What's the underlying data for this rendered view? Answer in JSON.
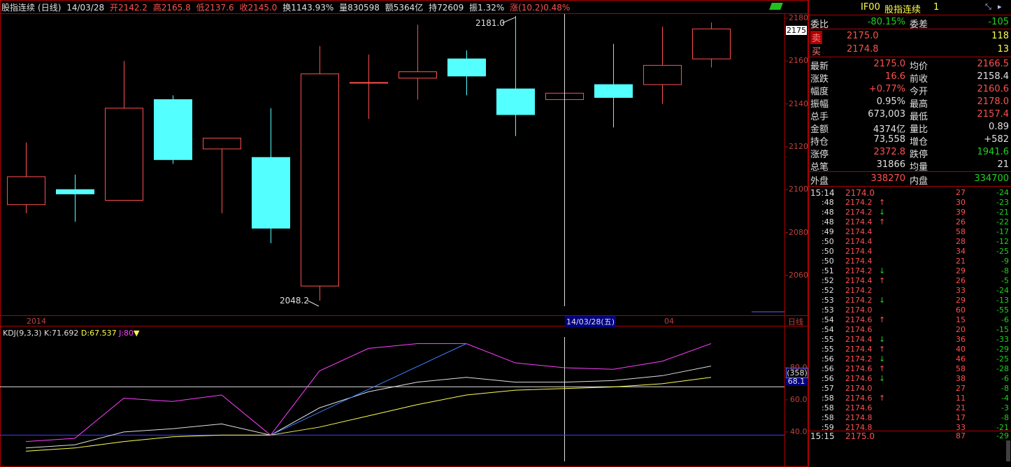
{
  "header": {
    "name": "股指连续",
    "period": "(日线)",
    "date": "14/03/28",
    "open": "开2142.2",
    "high": "高2165.8",
    "low": "低2137.6",
    "close": "收2145.0",
    "turnover": "换1143.93%",
    "volume": "量830598",
    "amount": "额5364亿",
    "hold": "持72609",
    "amplitude": "振1.32%",
    "change": "涨(10.2)0.48%"
  },
  "chart_data": [
    {
      "type": "candlestick",
      "title": "股指连续 (日线)",
      "y_ticks": [
        "2180",
        "2160",
        "2140",
        "2120",
        "2100",
        "2080",
        "2060"
      ],
      "ylim": [
        2044,
        2184
      ],
      "candles": [
        {
          "open": 2093,
          "close": 2106,
          "high": 2122,
          "low": 2089
        },
        {
          "open": 2100,
          "close": 2098,
          "high": 2107,
          "low": 2085
        },
        {
          "open": 2095,
          "close": 2138,
          "high": 2160,
          "low": 2095
        },
        {
          "open": 2142,
          "close": 2114,
          "high": 2144,
          "low": 2112
        },
        {
          "open": 2119,
          "close": 2124,
          "high": 2124,
          "low": 2089
        },
        {
          "open": 2115,
          "close": 2082,
          "high": 2138,
          "low": 2075
        },
        {
          "open": 2055,
          "close": 2154,
          "high": 2167,
          "low": 2048.2
        },
        {
          "open": 2150,
          "close": 2150,
          "high": 2163,
          "low": 2133
        },
        {
          "open": 2152,
          "close": 2155,
          "high": 2177,
          "low": 2142
        },
        {
          "open": 2161,
          "close": 2153,
          "high": 2165,
          "low": 2144
        },
        {
          "open": 2147,
          "close": 2135,
          "high": 2181,
          "low": 2125
        },
        {
          "open": 2142,
          "close": 2145,
          "high": 2166,
          "low": 2137
        },
        {
          "open": 2149,
          "close": 2143,
          "high": 2168,
          "low": 2129
        },
        {
          "open": 2149,
          "close": 2158,
          "high": 2176,
          "low": 2140
        },
        {
          "open": 2161,
          "close": 2175,
          "high": 2178,
          "low": 2157
        }
      ],
      "annotations": {
        "high_label": "2181.0",
        "low_label": "2048.2"
      },
      "price_tag": "2175",
      "x_labels": {
        "year": "2014",
        "month": "04",
        "cursor_date": "14/03/28(五)",
        "period_btn": "日线"
      }
    },
    {
      "type": "line",
      "title": "KDJ(9,3,3)",
      "ylim": [
        25,
        100
      ],
      "y_ticks": [
        "80.0",
        "60.0",
        "40.0"
      ],
      "legend": [
        {
          "label": "K:71.692",
          "color": "#e0e0e0"
        },
        {
          "label": "D:67.537",
          "color": "#ffff50"
        },
        {
          "label": "J:80",
          "color": "#ff40ff"
        }
      ],
      "series": [
        {
          "name": "K",
          "color": "#e0e0e0",
          "values": [
            30,
            32,
            40,
            42,
            45,
            38,
            55,
            65,
            71,
            74,
            71,
            71,
            72,
            75,
            81
          ]
        },
        {
          "name": "D",
          "color": "#ffff50",
          "values": [
            28,
            30,
            34,
            37,
            38,
            38,
            43,
            50,
            57,
            63,
            66,
            67,
            68,
            70,
            74
          ]
        },
        {
          "name": "J",
          "color": "#ff40ff",
          "values": [
            34,
            36,
            61,
            59,
            63,
            38,
            78,
            92,
            95,
            95,
            83,
            80,
            79,
            84,
            95
          ]
        }
      ],
      "cursor_value": "68.1",
      "cursor_count": "(358)"
    }
  ],
  "panel": {
    "code": "IF00",
    "name": "股指连续",
    "index": "1",
    "weibi_label": "委比",
    "weibi": "-80.15%",
    "weicha_label": "委差",
    "weicha": "-105",
    "sell_label": "卖",
    "sell_price": "2175.0",
    "sell_vol": "118",
    "buy_label": "买",
    "buy_price": "2174.8",
    "buy_vol": "13",
    "stats": [
      {
        "l1": "最新",
        "v1": "2175.0",
        "c1": "#ff5050",
        "l2": "均价",
        "v2": "2166.5",
        "c2": "#ff5050"
      },
      {
        "l1": "涨跌",
        "v1": "16.6",
        "c1": "#ff5050",
        "l2": "前收",
        "v2": "2158.4",
        "c2": "#e0e0e0"
      },
      {
        "l1": "幅度",
        "v1": "+0.77%",
        "c1": "#ff5050",
        "l2": "今开",
        "v2": "2160.6",
        "c2": "#ff5050"
      },
      {
        "l1": "振幅",
        "v1": "0.95%",
        "c1": "#e0e0e0",
        "l2": "最高",
        "v2": "2178.0",
        "c2": "#ff5050"
      },
      {
        "l1": "总手",
        "v1": "673,003",
        "c1": "#e0e0e0",
        "l2": "最低",
        "v2": "2157.4",
        "c2": "#ff5050"
      },
      {
        "l1": "金额",
        "v1": "4374亿",
        "c1": "#e0e0e0",
        "l2": "量比",
        "v2": "0.89",
        "c2": "#e0e0e0"
      },
      {
        "l1": "持仓",
        "v1": "73,558",
        "c1": "#e0e0e0",
        "l2": "增仓",
        "v2": "+582",
        "c2": "#e0e0e0"
      },
      {
        "l1": "涨停",
        "v1": "2372.8",
        "c1": "#ff5050",
        "l2": "跌停",
        "v2": "1941.6",
        "c2": "#20d020"
      },
      {
        "l1": "总笔",
        "v1": "31866",
        "c1": "#e0e0e0",
        "l2": "均量",
        "v2": "21",
        "c2": "#e0e0e0"
      }
    ],
    "outer_label": "外盘",
    "outer": "338270",
    "inner_label": "内盘",
    "inner": "334700",
    "ticks": [
      {
        "t": "15:14",
        "p": "2174.0",
        "a": "",
        "v": "27",
        "d": "-24"
      },
      {
        "t": ":48",
        "p": "2174.2",
        "a": "↑",
        "v": "30",
        "d": "-23"
      },
      {
        "t": ":48",
        "p": "2174.2",
        "a": "↓",
        "v": "39",
        "d": "-21"
      },
      {
        "t": ":48",
        "p": "2174.4",
        "a": "↑",
        "v": "26",
        "d": "-22"
      },
      {
        "t": ":49",
        "p": "2174.4",
        "a": "",
        "v": "58",
        "d": "-17"
      },
      {
        "t": ":50",
        "p": "2174.4",
        "a": "",
        "v": "28",
        "d": "-12"
      },
      {
        "t": ":50",
        "p": "2174.4",
        "a": "",
        "v": "34",
        "d": "-25"
      },
      {
        "t": ":50",
        "p": "2174.4",
        "a": "",
        "v": "21",
        "d": "-9"
      },
      {
        "t": ":51",
        "p": "2174.2",
        "a": "↓",
        "v": "29",
        "d": "-8"
      },
      {
        "t": ":52",
        "p": "2174.4",
        "a": "↑",
        "v": "26",
        "d": "-5"
      },
      {
        "t": ":52",
        "p": "2174.2",
        "a": "",
        "v": "33",
        "d": "-24"
      },
      {
        "t": ":53",
        "p": "2174.2",
        "a": "↓",
        "v": "29",
        "d": "-13"
      },
      {
        "t": ":53",
        "p": "2174.0",
        "a": "",
        "v": "60",
        "d": "-55"
      },
      {
        "t": ":54",
        "p": "2174.6",
        "a": "↑",
        "v": "15",
        "d": "-6"
      },
      {
        "t": ":54",
        "p": "2174.6",
        "a": "",
        "v": "20",
        "d": "-15"
      },
      {
        "t": ":55",
        "p": "2174.4",
        "a": "↓",
        "v": "36",
        "d": "-33"
      },
      {
        "t": ":55",
        "p": "2174.4",
        "a": "↑",
        "v": "40",
        "d": "-29"
      },
      {
        "t": ":56",
        "p": "2174.2",
        "a": "↓",
        "v": "46",
        "d": "-25"
      },
      {
        "t": ":56",
        "p": "2174.6",
        "a": "↑",
        "v": "58",
        "d": "-28"
      },
      {
        "t": ":56",
        "p": "2174.6",
        "a": "↓",
        "v": "38",
        "d": "-6"
      },
      {
        "t": ":57",
        "p": "2174.0",
        "a": "",
        "v": "27",
        "d": "-8"
      },
      {
        "t": ":58",
        "p": "2174.6",
        "a": "↑",
        "v": "11",
        "d": "-4"
      },
      {
        "t": ":58",
        "p": "2174.6",
        "a": "",
        "v": "21",
        "d": "-3"
      },
      {
        "t": ":58",
        "p": "2174.8",
        "a": "",
        "v": "17",
        "d": "-8"
      },
      {
        "t": ":59",
        "p": "2174.8",
        "a": "",
        "v": "33",
        "d": "-21"
      },
      {
        "t": "15:15",
        "p": "2175.0",
        "a": "",
        "v": "87",
        "d": "-29"
      }
    ]
  },
  "colors": {
    "up": "#ff5050",
    "down": "#54ffff",
    "grid": "#b00000",
    "axis_text": "#c04040"
  }
}
